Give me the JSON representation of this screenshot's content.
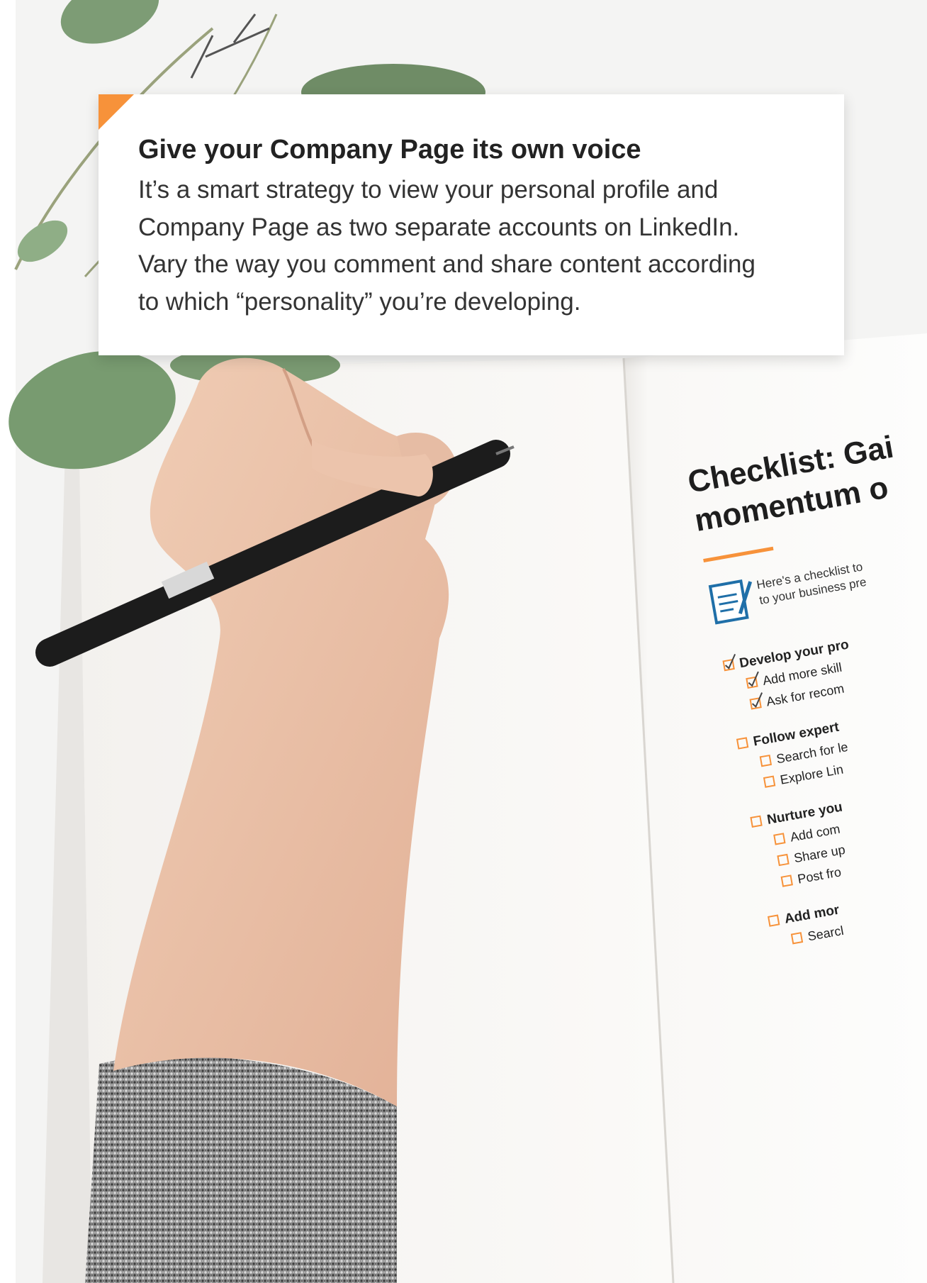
{
  "callout": {
    "title": "Give your Company Page its own voice",
    "body_lines": [
      "It’s a smart strategy to view your personal profile and",
      "Company Page as two separate accounts on LinkedIn.",
      "Vary the way you comment and share content according",
      "to which “personality” you’re developing."
    ]
  },
  "notebook": {
    "heading_lines": [
      "Checklist: Gai",
      "momentum o"
    ],
    "intro_lines": [
      "Here's a checklist to",
      "to your business pre"
    ],
    "items": [
      {
        "text": "Develop your pro",
        "level": 0,
        "checked": true
      },
      {
        "text": "Add more skill",
        "level": 1,
        "checked": true
      },
      {
        "text": "Ask for recom",
        "level": 1,
        "checked": true
      },
      {
        "text": "Follow expert",
        "level": 0,
        "checked": false
      },
      {
        "text": "Search for le",
        "level": 1,
        "checked": false
      },
      {
        "text": "Explore Lin",
        "level": 1,
        "checked": false
      },
      {
        "text": "Nurture you",
        "level": 0,
        "checked": false
      },
      {
        "text": "Add com",
        "level": 1,
        "checked": false
      },
      {
        "text": "Share up",
        "level": 1,
        "checked": false
      },
      {
        "text": "Post fro",
        "level": 1,
        "checked": false
      },
      {
        "text": "Add mor",
        "level": 0,
        "checked": false
      },
      {
        "text": "Searcl",
        "level": 1,
        "checked": false
      }
    ]
  },
  "colors": {
    "accent": "#f7923a",
    "title_text": "#222222",
    "body_text": "#333333",
    "icon_blue": "#1f6fa8"
  }
}
